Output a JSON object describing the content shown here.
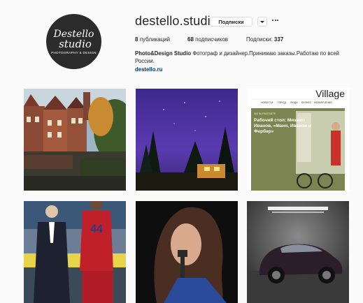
{
  "profile": {
    "avatar_line1": "Destello",
    "avatar_line2": "studio",
    "avatar_line3": "PHOTOGRAPHY & DESIGN",
    "username": "destello.studio",
    "follow_label": "Подписки",
    "stats": {
      "posts_count": "8",
      "posts_label": "публикаций",
      "followers_count": "68",
      "followers_label": "подписчиков",
      "following_label": "Подписки:",
      "following_count": "337"
    },
    "bio_name": "Photo&Design Studio",
    "bio_text": "Фотограф и дизайнер.Принимаю заказы.Работаю по всей России.",
    "website": "destello.ru"
  },
  "posts": {
    "post3": {
      "magazine_logo": "Village",
      "nav_items": [
        "НОВОСТИ",
        "ГОРОД",
        "ЛЮДИ",
        "БИЗНЕС",
        "РАЗВЛЕЧЕНИЯ"
      ],
      "headline_kicker": "КАК ВЫ РАБОТАЕТЕ",
      "headline": "Рабочий стол: Михаил Иванов, «Мани, Иванов и Фербер»"
    },
    "post4": {
      "jersey_number": "44"
    }
  },
  "colors": {
    "link": "#003569",
    "border": "#dbdbdb",
    "background": "#fafafa"
  }
}
